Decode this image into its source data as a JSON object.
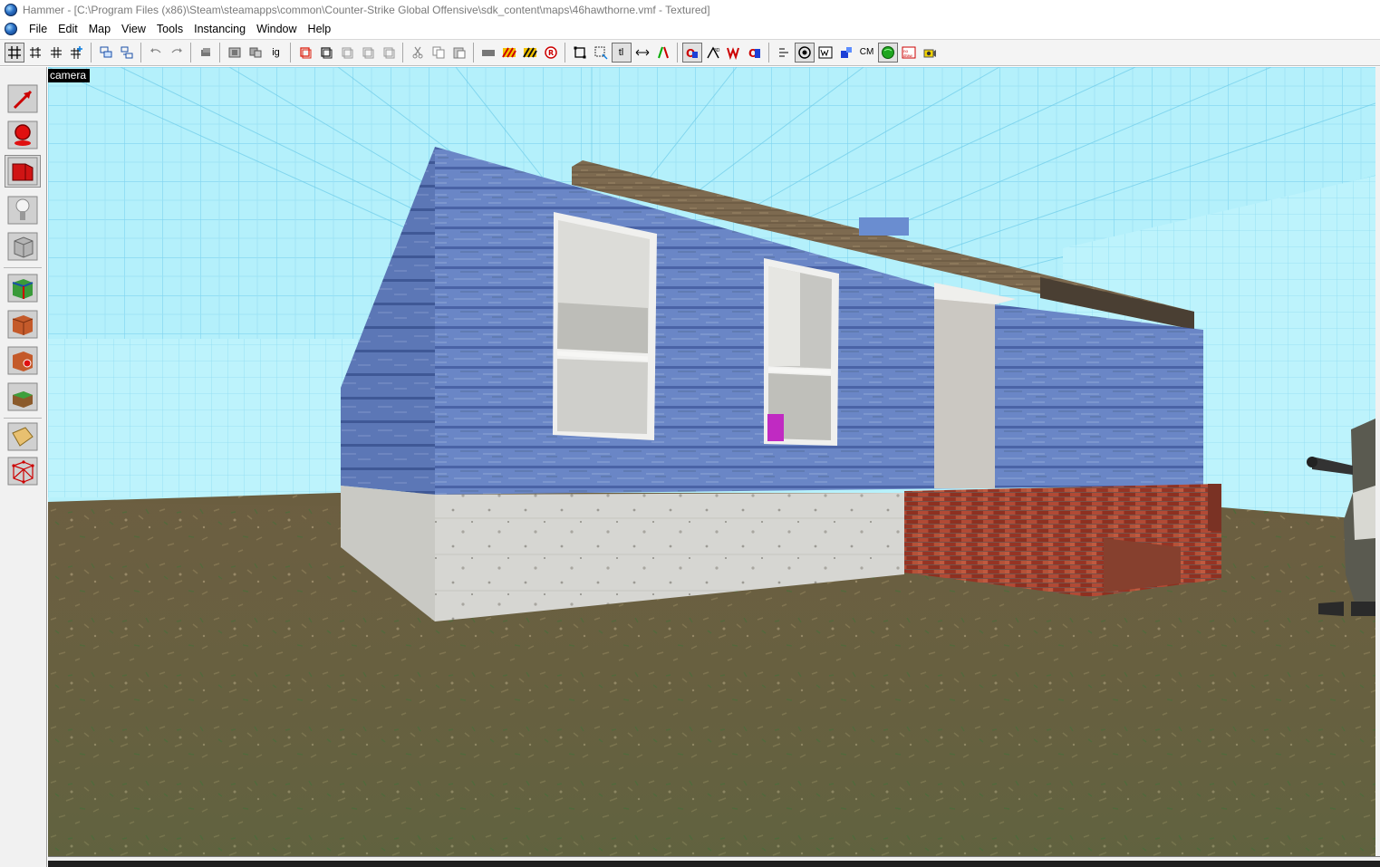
{
  "window": {
    "title": "Hammer - [C:\\Program Files (x86)\\Steam\\steamapps\\common\\Counter-Strike Global Offensive\\sdk_content\\maps\\46hawthorne.vmf - Textured]"
  },
  "menu": {
    "items": [
      {
        "label": "File"
      },
      {
        "label": "Edit"
      },
      {
        "label": "Map"
      },
      {
        "label": "View"
      },
      {
        "label": "Tools"
      },
      {
        "label": "Instancing"
      },
      {
        "label": "Window"
      },
      {
        "label": "Help"
      }
    ]
  },
  "toolbar": {
    "buttons": [
      {
        "icon": "grid-toggle-icon"
      },
      {
        "icon": "3d-grid-icon"
      },
      {
        "icon": "smaller-grid-icon"
      },
      {
        "icon": "larger-grid-icon"
      },
      {
        "icon": "group-icon"
      },
      {
        "icon": "ungroup-icon"
      },
      {
        "icon": "undo-icon"
      },
      {
        "icon": "redo-icon"
      },
      {
        "icon": "carve-icon"
      },
      {
        "icon": "hide-selected-icon"
      },
      {
        "icon": "show-all-icon"
      },
      {
        "icon": "ignore-groups-icon",
        "text": "ig"
      },
      {
        "icon": "selection-a-icon"
      },
      {
        "icon": "selection-b-icon"
      },
      {
        "icon": "selection-c-icon"
      },
      {
        "icon": "selection-d-icon"
      },
      {
        "icon": "selection-e-icon"
      },
      {
        "icon": "cut-icon"
      },
      {
        "icon": "copy-icon"
      },
      {
        "icon": "paste-icon"
      },
      {
        "icon": "tie-to-world-icon"
      },
      {
        "icon": "hazard-a-icon"
      },
      {
        "icon": "hazard-b-icon"
      },
      {
        "icon": "run-map-icon"
      },
      {
        "icon": "texture-lock-icon"
      },
      {
        "icon": "selection-box-icon"
      },
      {
        "icon": "texture-lock-tl-icon",
        "text": "tl"
      },
      {
        "icon": "move-tl-icon",
        "text": "tl"
      },
      {
        "icon": "flip-icon"
      },
      {
        "icon": "brush-view-icon"
      },
      {
        "icon": "measure-icon"
      },
      {
        "icon": "wireframe-icon"
      },
      {
        "icon": "entity-view-icon"
      },
      {
        "icon": "link-icon"
      },
      {
        "icon": "model-icon"
      },
      {
        "icon": "vis-icon"
      },
      {
        "icon": "cube-map-icon"
      },
      {
        "icon": "cubemap-text-icon",
        "text": "CM"
      },
      {
        "icon": "green-sphere-icon"
      },
      {
        "icon": "no-draw-icon"
      },
      {
        "icon": "camera-icon"
      }
    ]
  },
  "tools": [
    {
      "name": "selection-tool",
      "icon": "pointer-icon"
    },
    {
      "name": "magnify-tool",
      "icon": "magnify-icon"
    },
    {
      "name": "camera-tool",
      "icon": "camera-icon"
    },
    {
      "name": "entity-tool",
      "icon": "lightbulb-icon"
    },
    {
      "name": "block-tool",
      "icon": "block-icon"
    },
    {
      "name": "texture-application-tool",
      "icon": "texture-cube-icon"
    },
    {
      "name": "apply-texture-tool",
      "icon": "brick-icon"
    },
    {
      "name": "decal-tool",
      "icon": "decal-icon"
    },
    {
      "name": "overlay-tool",
      "icon": "grass-icon"
    },
    {
      "name": "clipping-tool",
      "icon": "clip-icon"
    },
    {
      "name": "vertex-tool",
      "icon": "vertex-icon"
    }
  ],
  "viewport": {
    "label": "camera",
    "render_mode": "Textured"
  }
}
